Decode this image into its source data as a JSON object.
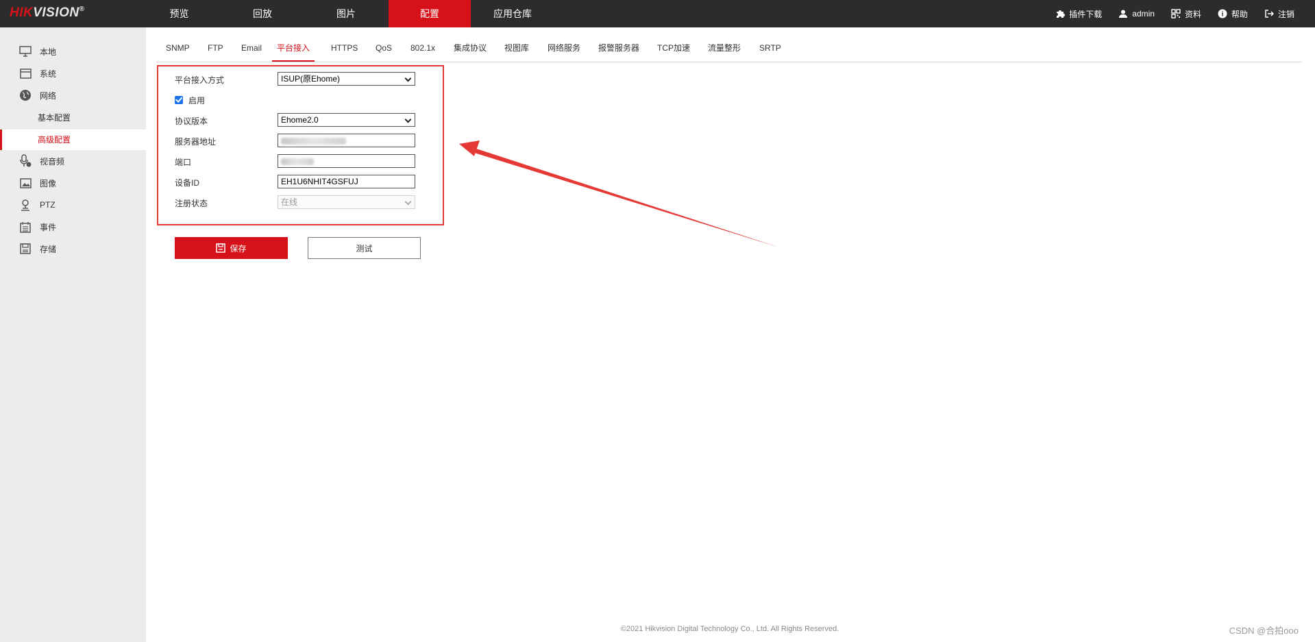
{
  "header": {
    "logo_brand": "HIKVISION",
    "logo_brand_red": "HIK",
    "logo_brand_rest": "VISION",
    "logo_mark": "®",
    "nav": [
      {
        "label": "预览"
      },
      {
        "label": "回放"
      },
      {
        "label": "图片"
      },
      {
        "label": "配置",
        "active": true
      },
      {
        "label": "应用仓库"
      }
    ],
    "tools": [
      {
        "label": "插件下载",
        "icon": "puzzle-icon"
      },
      {
        "label": "admin",
        "icon": "user-icon"
      },
      {
        "label": "资料",
        "icon": "qrcode-icon"
      },
      {
        "label": "帮助",
        "icon": "help-icon"
      },
      {
        "label": "注销",
        "icon": "logout-icon"
      }
    ]
  },
  "sidebar": {
    "items": [
      {
        "label": "本地",
        "icon": "monitor-icon"
      },
      {
        "label": "系统",
        "icon": "system-icon"
      },
      {
        "label": "网络",
        "icon": "globe-icon"
      },
      {
        "label": "基本配置"
      },
      {
        "label": "高级配置",
        "active": true
      },
      {
        "label": "视音频",
        "icon": "mic-video-icon"
      },
      {
        "label": "图像",
        "icon": "image-icon"
      },
      {
        "label": "PTZ",
        "icon": "ptz-icon"
      },
      {
        "label": "事件",
        "icon": "calendar-icon"
      },
      {
        "label": "存储",
        "icon": "storage-icon"
      }
    ]
  },
  "tabs": [
    {
      "label": "SNMP"
    },
    {
      "label": "FTP"
    },
    {
      "label": "Email"
    },
    {
      "label": "平台接入",
      "active": true
    },
    {
      "label": "HTTPS"
    },
    {
      "label": "QoS"
    },
    {
      "label": "802.1x"
    },
    {
      "label": "集成协议"
    },
    {
      "label": "视图库"
    },
    {
      "label": "网络服务"
    },
    {
      "label": "报警服务器"
    },
    {
      "label": "TCP加速"
    },
    {
      "label": "流量整形"
    },
    {
      "label": "SRTP"
    }
  ],
  "form": {
    "access_mode": {
      "label": "平台接入方式",
      "value": "ISUP(原Ehome)"
    },
    "enable": {
      "label": "启用",
      "checked": true
    },
    "protocol_version": {
      "label": "协议版本",
      "value": "Ehome2.0"
    },
    "server_address": {
      "label": "服务器地址",
      "value": ""
    },
    "port": {
      "label": "端口",
      "value": ""
    },
    "device_id": {
      "label": "设备ID",
      "value": "EH1U6NHIT4GSFUJ"
    },
    "register_status": {
      "label": "注册状态",
      "value": "在线"
    }
  },
  "buttons": {
    "save_label": "保存",
    "test_label": "测试"
  },
  "footer": {
    "copyright": "©2021 Hikvision Digital Technology Co., Ltd. All Rights Reserved.",
    "watermark": "CSDN @合拍ooo"
  },
  "colors": {
    "brand_red": "#d7111a",
    "topbar_bg": "#2c2c2c",
    "sidebar_bg": "#ececec",
    "annotation_red": "#e53935",
    "checkbox_blue": "#1a73e8"
  }
}
